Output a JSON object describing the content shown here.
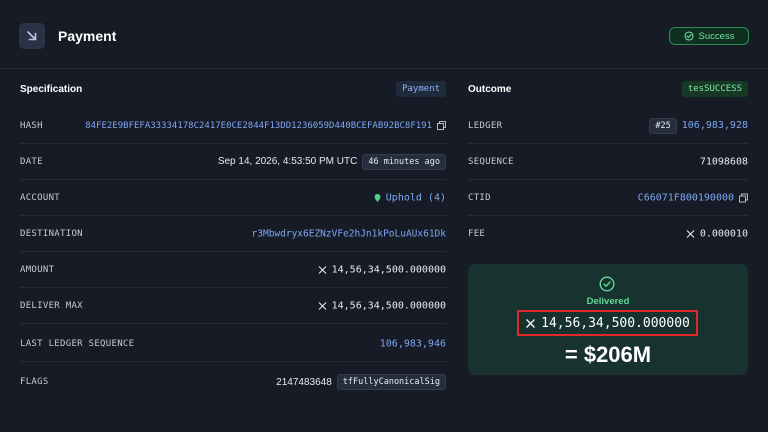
{
  "header": {
    "title": "Payment",
    "icon": "arrow-down-right-icon",
    "status": "Success"
  },
  "specification": {
    "heading": "Specification",
    "tag": "Payment",
    "rows": [
      {
        "label": "HASH",
        "value": "84FE2E9BFEFA33334178C2417E0CE2844F13DD1236059D440BCEFAB92BC8F191"
      },
      {
        "label": "DATE",
        "value": "Sep 14, 2026, 4:53:50 PM UTC",
        "chip": "46 minutes ago"
      },
      {
        "label": "ACCOUNT",
        "value": "Uphold (4)"
      },
      {
        "label": "DESTINATION",
        "value": "r3Mbwdryx6EZNzVFe2hJn1kPoLuAUx61Dk"
      },
      {
        "label": "AMOUNT",
        "value": "14,56,34,500.000000"
      },
      {
        "label": "DELIVER MAX",
        "value": "14,56,34,500.000000"
      },
      {
        "label": "LAST LEDGER SEQUENCE",
        "value": "106,983,946"
      },
      {
        "label": "FLAGS",
        "value": "2147483648",
        "chip": "tfFullyCanonicalSig"
      }
    ]
  },
  "outcome": {
    "heading": "Outcome",
    "tag": "tesSUCCESS",
    "rows": [
      {
        "label": "LEDGER",
        "chip": "#25",
        "value": "106,983,928"
      },
      {
        "label": "SEQUENCE",
        "value": "71098608"
      },
      {
        "label": "CTID",
        "value": "C66071F800190000"
      },
      {
        "label": "FEE",
        "value": "0.000010"
      }
    ],
    "delivered": {
      "label": "Delivered",
      "amount": "14,56,34,500.000000",
      "usd": "= $206M"
    }
  },
  "colors": {
    "background": "#161b26",
    "success": "#5fdb93",
    "link": "#7ea7f2",
    "highlight": "#e02a2a"
  }
}
